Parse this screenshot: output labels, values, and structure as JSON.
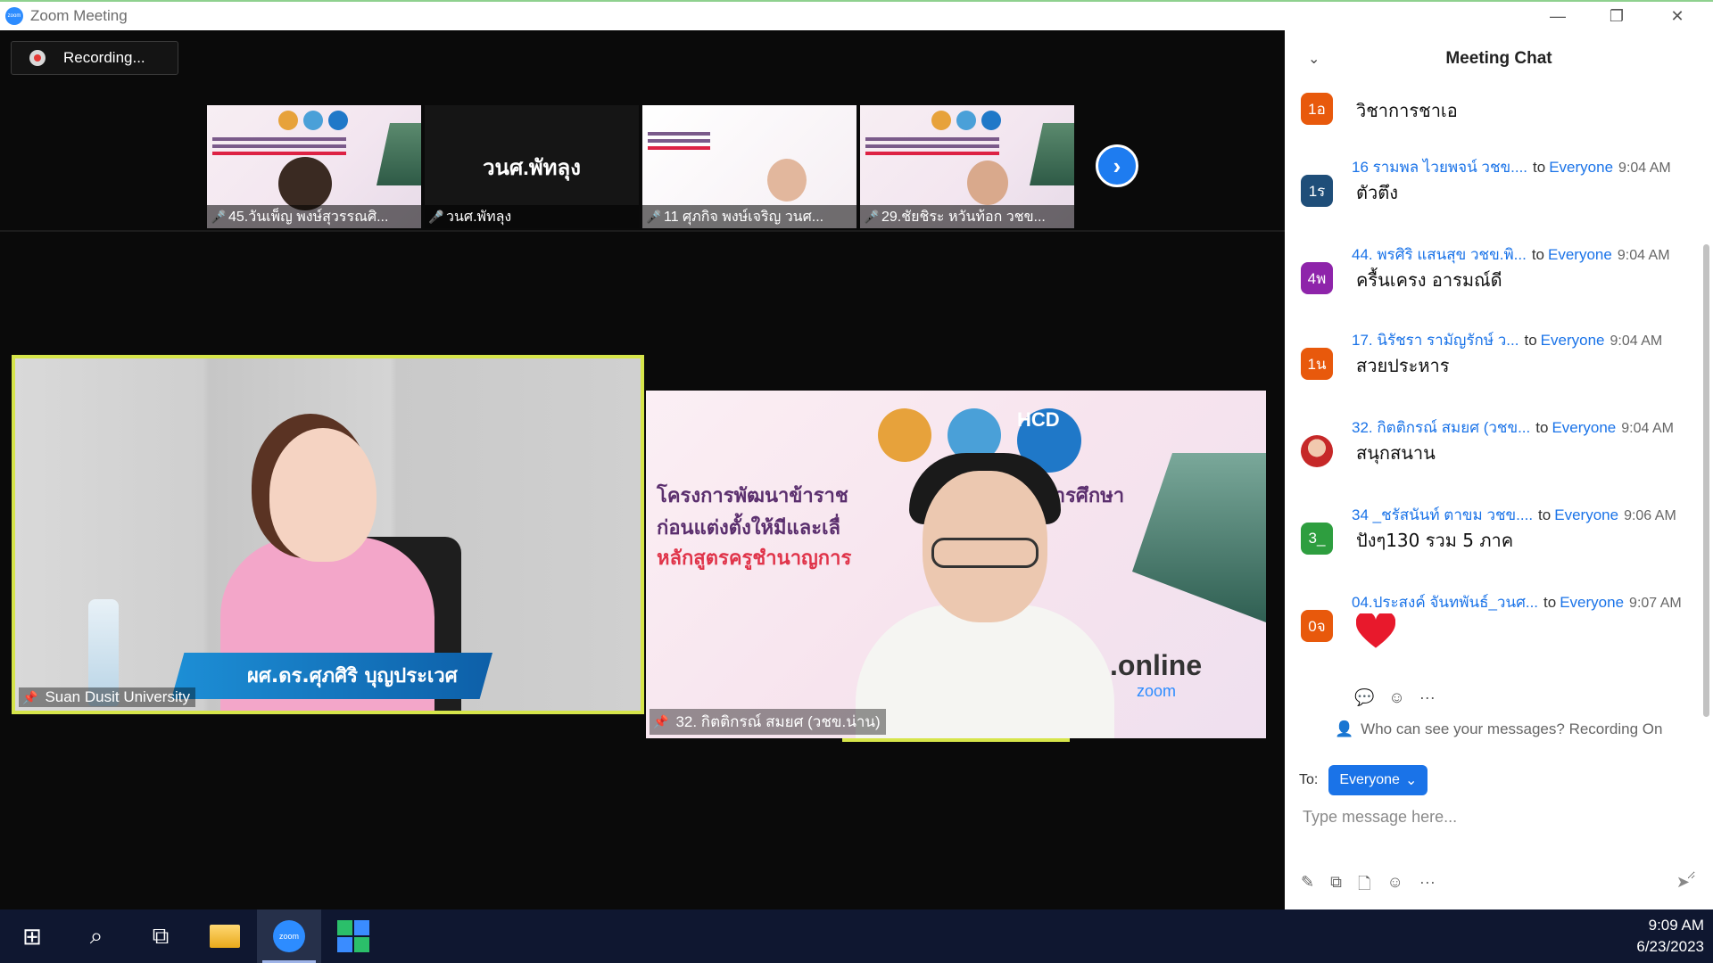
{
  "window": {
    "title": "Zoom Meeting",
    "app_icon_text": "zoom",
    "minimize": "—",
    "restore": "❐",
    "close": "✕"
  },
  "recording": {
    "label": "Recording..."
  },
  "thumbnails": [
    {
      "name": "45.วันเพ็ญ พงษ์สุวรรณศิ...",
      "muted": true,
      "type": "slide"
    },
    {
      "name": "วนศ.พัทลุง",
      "muted": true,
      "type": "plain",
      "display_text": "วนศ.พัทลุง"
    },
    {
      "name": "11 ศุภกิจ พงษ์เจริญ วนศ...",
      "muted": true,
      "type": "slide"
    },
    {
      "name": "29.ชัยชิระ หวันท้อก วชข...",
      "muted": true,
      "type": "slide"
    }
  ],
  "next_button": "›",
  "main_tiles": {
    "speaker": {
      "label": "Suan Dusit University",
      "caption_name": "ผศ.ดร.ศุภศิริ บุญประเวศ"
    },
    "second": {
      "label": "32. กิตติกรณ์ สมยศ (วชข.น่าน)",
      "slide_title_1": "โครงการพัฒนาข้าราช",
      "slide_title_1b": "รหางการศึกษา",
      "slide_title_2": "ก่อนแต่งตั้งให้มีและเลื่",
      "slide_title_3": "หลักสูตรครูชำนาญการ",
      "hcd_logo": "HCD",
      "online_text": ".online",
      "zoom_text": "zoom"
    }
  },
  "chat": {
    "title": "Meeting Chat",
    "collapse_icon": "⌄",
    "to_word": "to",
    "messages": [
      {
        "sender": "",
        "target": "",
        "time": "",
        "avatar": "1อ",
        "avatar_color": "#e8590c",
        "text": "วิชาการชาเอ",
        "is_heart": false
      },
      {
        "sender": "16 รามพล ไวยพจน์ วชข....",
        "target": "Everyone",
        "time": "9:04 AM",
        "avatar": "1ร",
        "avatar_color": "#1f4e79",
        "text": "ตัวตึง",
        "is_heart": false
      },
      {
        "sender": "44. พรศิริ แสนสุข วชข.พิ...",
        "target": "Everyone",
        "time": "9:04 AM",
        "avatar": "4พ",
        "avatar_color": "#8e24aa",
        "text": "ครื้นเครง อารมณ์ดี",
        "is_heart": false
      },
      {
        "sender": "17. นิรัชรา  รามัญรักษ์  ว...",
        "target": "Everyone",
        "time": "9:04 AM",
        "avatar": "1น",
        "avatar_color": "#e8590c",
        "text": "สวยประหาร",
        "is_heart": false
      },
      {
        "sender": "32. กิตติกรณ์ สมยศ (วชข...",
        "target": "Everyone",
        "time": "9:04 AM",
        "avatar": "photo",
        "avatar_color": "#c62828",
        "text": "สนุกสนาน",
        "is_heart": false
      },
      {
        "sender": "34 _ชรัสนันท์ ตาขม วชข....",
        "target": "Everyone",
        "time": "9:06 AM",
        "avatar": "3_",
        "avatar_color": "#2e9e3f",
        "text": "ปังๆ130 รวม 5 ภาค",
        "is_heart": false
      },
      {
        "sender": "04.ประสงค์ จันทพันธ์_วนศ...",
        "target": "Everyone",
        "time": "9:07 AM",
        "avatar": "0จ",
        "avatar_color": "#e8590c",
        "text": "",
        "is_heart": true
      }
    ],
    "privacy_note": "Who can see your messages? Recording On",
    "to_label": "To:",
    "recipient": "Everyone",
    "input_placeholder": "Type message here..."
  },
  "taskbar": {
    "start_icon": "⊞",
    "search_icon": "⌕",
    "zoom_icon_text": "zoom",
    "clock_time": "9:09 AM",
    "clock_date": "6/23/2023"
  }
}
